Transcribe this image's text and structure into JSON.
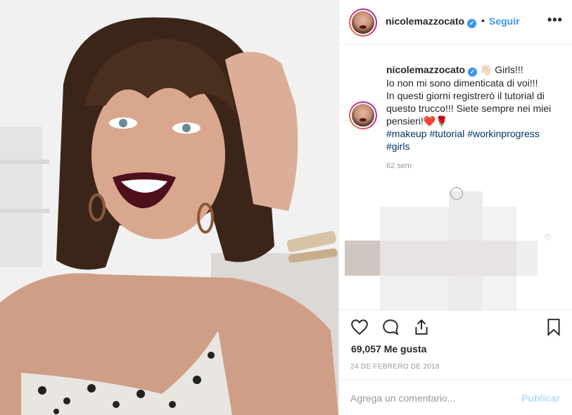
{
  "post": {
    "username": "nicolemazzocato",
    "verified_mark": "✓",
    "separator": "•",
    "follow_label": "Seguir",
    "more_label": "•••"
  },
  "caption": {
    "username": "nicolemazzocato",
    "verified_mark": "✓",
    "line1": "👋🏻 Girls!!!",
    "line2": "Io non mi sono dimenticata di voi!!!",
    "line3": "In questi giorni registrerò il tutorial di questo trucco!!! Siete sempre nei miei pensieri!❤️🌹",
    "hashtags": [
      "#makeup",
      "#tutorial",
      "#workinprogress",
      "#girls"
    ],
    "time": "62 sem"
  },
  "actions": {
    "like_icon": "heart-icon",
    "comment_icon": "comment-icon",
    "share_icon": "share-icon",
    "save_icon": "bookmark-icon"
  },
  "likes": "69,057 Me gusta",
  "date": "24 DE FEBRERO DE 2018",
  "comment": {
    "placeholder": "Agrega un comentario...",
    "publish_label": "Publicar"
  },
  "colors": {
    "link": "#3897f0",
    "hashtag": "#003569",
    "muted": "#999999",
    "publish_disabled": "#b2dffc"
  }
}
